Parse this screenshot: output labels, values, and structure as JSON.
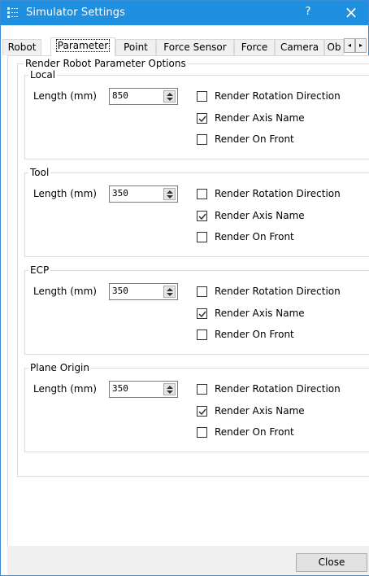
{
  "window": {
    "title": "Simulator Settings",
    "help_label": "?",
    "close_label": "×"
  },
  "tabs": [
    {
      "label": "Robot"
    },
    {
      "label": "Parameter",
      "selected": true
    },
    {
      "label": "Point"
    },
    {
      "label": "Force Sensor"
    },
    {
      "label": "Force"
    },
    {
      "label": "Camera"
    },
    {
      "label": "Ob"
    }
  ],
  "tab_scroll": {
    "left": "◂",
    "right": "▸"
  },
  "options": {
    "title": "Render Robot Parameter Options",
    "groups": [
      {
        "name": "Local",
        "length_label": "Length (mm)",
        "length_value": "850",
        "checks": [
          {
            "label": "Render Rotation Direction",
            "checked": false
          },
          {
            "label": "Render Axis Name",
            "checked": true
          },
          {
            "label": "Render On Front",
            "checked": false
          }
        ]
      },
      {
        "name": "Tool",
        "length_label": "Length (mm)",
        "length_value": "350",
        "checks": [
          {
            "label": "Render Rotation Direction",
            "checked": false
          },
          {
            "label": "Render Axis Name",
            "checked": true
          },
          {
            "label": "Render On Front",
            "checked": false
          }
        ]
      },
      {
        "name": "ECP",
        "length_label": "Length (mm)",
        "length_value": "350",
        "checks": [
          {
            "label": "Render Rotation Direction",
            "checked": false
          },
          {
            "label": "Render Axis Name",
            "checked": true
          },
          {
            "label": "Render On Front",
            "checked": false
          }
        ]
      },
      {
        "name": "Plane Origin",
        "length_label": "Length (mm)",
        "length_value": "350",
        "checks": [
          {
            "label": "Render Rotation Direction",
            "checked": false
          },
          {
            "label": "Render Axis Name",
            "checked": true
          },
          {
            "label": "Render On Front",
            "checked": false
          }
        ]
      }
    ]
  },
  "footer": {
    "close_label": "Close"
  },
  "colors": {
    "titlebar": "#1f8fe0",
    "border": "#dcdcdc",
    "button": "#e1e1e1"
  },
  "icons": {
    "app": "settings-grid-icon",
    "spin": "spin-arrows-icon",
    "check": "checkmark-icon"
  }
}
